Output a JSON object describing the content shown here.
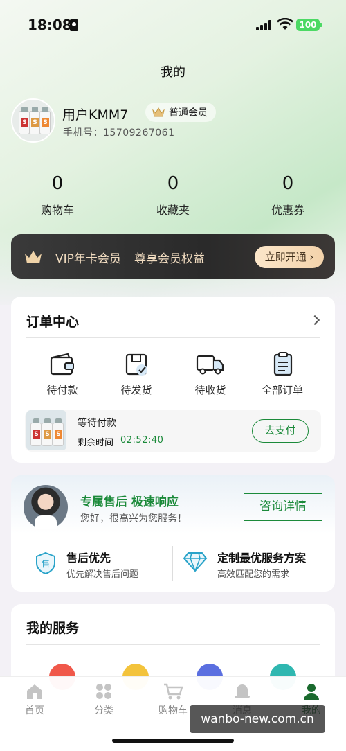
{
  "status_bar": {
    "time": "18:08",
    "battery": "100"
  },
  "page": {
    "title": "我的"
  },
  "profile": {
    "name": "用户KMM7",
    "member_level": "普通会员",
    "phone_label": "手机号：",
    "phone": "15709267061",
    "avatar_bottle_letter": "S"
  },
  "stats": [
    {
      "value": "0",
      "label": "购物车"
    },
    {
      "value": "0",
      "label": "收藏夹"
    },
    {
      "value": "0",
      "label": "优惠券"
    }
  ],
  "vip": {
    "title": "VIP年卡会员",
    "subtitle": "尊享会员权益",
    "button": "立即开通"
  },
  "orders": {
    "title": "订单中心",
    "items": [
      {
        "label": "待付款",
        "icon": "wallet-icon"
      },
      {
        "label": "待发货",
        "icon": "package-check-icon"
      },
      {
        "label": "待收货",
        "icon": "delivery-truck-icon"
      },
      {
        "label": "全部订单",
        "icon": "order-list-icon"
      }
    ],
    "pending": {
      "title": "等待付款",
      "remaining_label": "剩余时间",
      "remaining_time": "02:52:40",
      "button": "去支付"
    }
  },
  "after_sales": {
    "title": "专属售后 极速响应",
    "subtitle": "您好，很高兴为您服务！",
    "button": "咨询详情",
    "features": [
      {
        "title": "售后优先",
        "subtitle": "优先解决售后问题",
        "icon": "after-sales-shield-icon",
        "icon_text": "售"
      },
      {
        "title": "定制最优服务方案",
        "subtitle": "高效匹配您的需求",
        "icon": "diamond-icon"
      }
    ]
  },
  "my_services": {
    "title": "我的服务",
    "icon_colors": [
      "#f0584a",
      "#f3c33b",
      "#5b6fe0",
      "#2fb7b0"
    ]
  },
  "tabbar": [
    {
      "label": "首页",
      "icon": "home-icon",
      "active": false
    },
    {
      "label": "分类",
      "icon": "category-icon",
      "active": false
    },
    {
      "label": "购物车",
      "icon": "cart-icon",
      "active": false
    },
    {
      "label": "消息",
      "icon": "bell-icon",
      "active": false
    },
    {
      "label": "我的",
      "icon": "profile-icon",
      "active": true
    }
  ],
  "watermark": "wanbo-new.com.cn",
  "colors": {
    "brand_green": "#1b8a3a",
    "vip_gold": "#f1dcc0"
  }
}
